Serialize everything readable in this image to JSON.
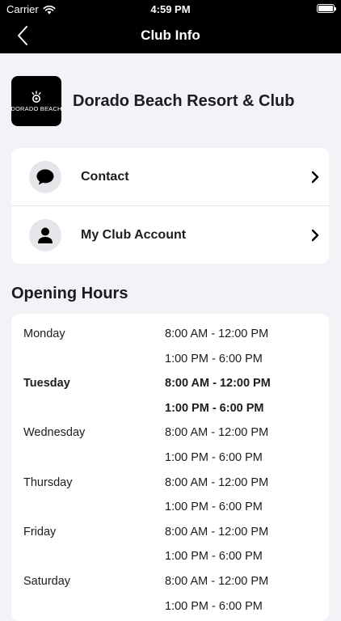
{
  "status_bar": {
    "carrier": "Carrier",
    "time": "4:59 PM"
  },
  "nav": {
    "title": "Club Info"
  },
  "club": {
    "name": "Dorado Beach Resort & Club",
    "logo_text": "DORADO BEACH"
  },
  "menu": [
    {
      "label": "Contact",
      "icon": "chat-bubble-icon"
    },
    {
      "label": "My Club Account",
      "icon": "user-icon"
    }
  ],
  "hours": {
    "title": "Opening Hours",
    "rows": [
      {
        "day": "Monday",
        "range": "8:00 AM - 12:00 PM",
        "today": false
      },
      {
        "day": "",
        "range": "1:00 PM - 6:00 PM",
        "today": false
      },
      {
        "day": "Tuesday",
        "range": "8:00 AM - 12:00 PM",
        "today": true
      },
      {
        "day": "",
        "range": "1:00 PM - 6:00 PM",
        "today": true
      },
      {
        "day": "Wednesday",
        "range": "8:00 AM - 12:00 PM",
        "today": false
      },
      {
        "day": "",
        "range": "1:00 PM - 6:00 PM",
        "today": false
      },
      {
        "day": "Thursday",
        "range": "8:00 AM - 12:00 PM",
        "today": false
      },
      {
        "day": "",
        "range": "1:00 PM - 6:00 PM",
        "today": false
      },
      {
        "day": "Friday",
        "range": "8:00 AM - 12:00 PM",
        "today": false
      },
      {
        "day": "",
        "range": "1:00 PM - 6:00 PM",
        "today": false
      },
      {
        "day": "Saturday",
        "range": "8:00 AM - 12:00 PM",
        "today": false
      },
      {
        "day": "",
        "range": "1:00 PM - 6:00 PM",
        "today": false
      }
    ]
  },
  "colors": {
    "header_bg": "#000000",
    "page_bg": "#f2f2f7",
    "card_bg": "#ffffff",
    "icon_circle": "#e5e5ea"
  }
}
